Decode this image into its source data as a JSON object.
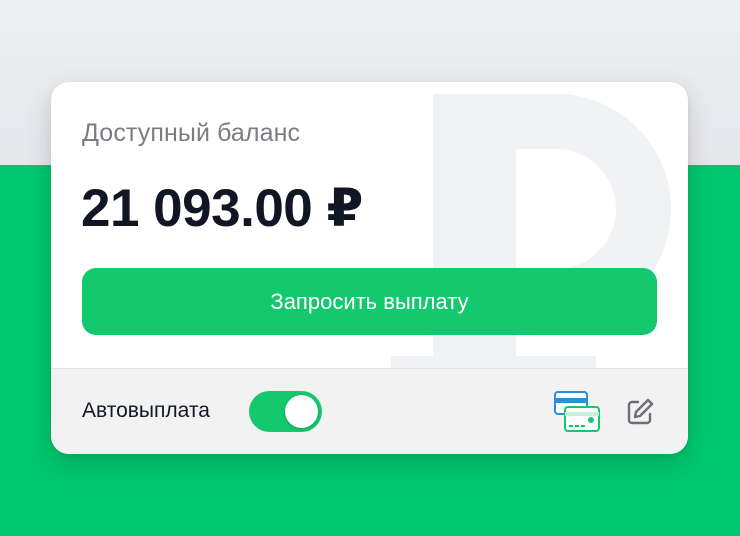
{
  "balance": {
    "label": "Доступный баланс",
    "amount": "21 093.00 ₽"
  },
  "actions": {
    "request_payout_label": "Запросить выплату"
  },
  "autopayout": {
    "label": "Автовыплата",
    "enabled": true
  },
  "icons": {
    "watermark": "ruble-sign-icon",
    "cards": "credit-cards-icon",
    "edit": "edit-pencil-icon"
  },
  "colors": {
    "accent": "#14c86e",
    "background_green": "#00c86e",
    "text_primary": "#101624",
    "text_secondary": "#7b7d83",
    "card_icon_blue": "#2a8fd6"
  }
}
